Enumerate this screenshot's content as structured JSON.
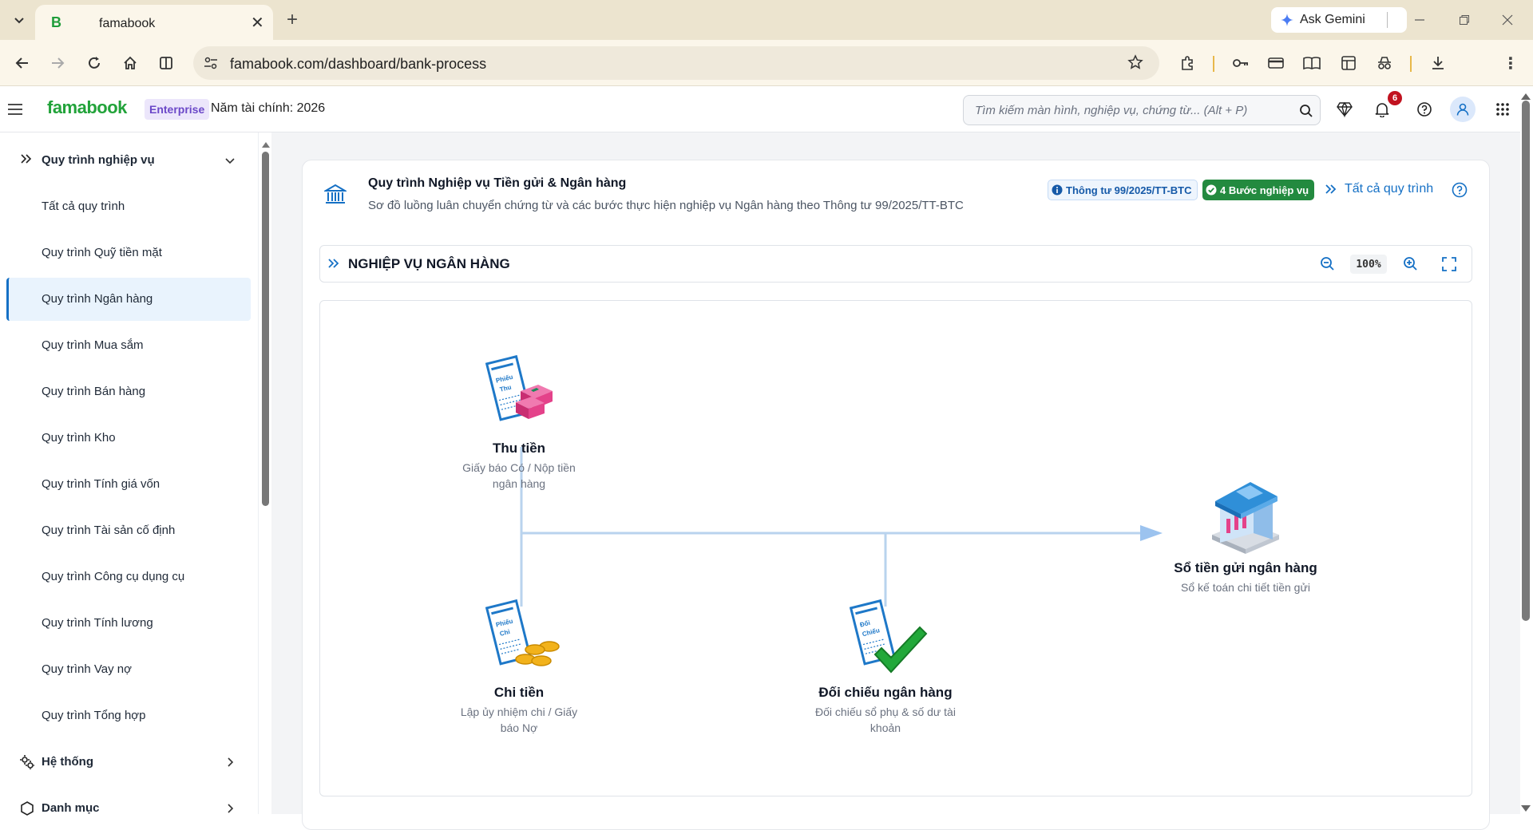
{
  "browser": {
    "tab_title": "famabook",
    "favicon_letter": "B",
    "url": "famabook.com/dashboard/bank-process",
    "gemini_label": "Ask Gemini"
  },
  "app": {
    "brand": "famabook",
    "plan_badge": "Enterprise",
    "fiscal_year": "Năm tài chính: 2026",
    "search_placeholder": "Tìm kiếm màn hình, nghiệp vụ, chứng từ... (Alt + P)",
    "notification_count": "6"
  },
  "sidebar": {
    "group_title": "Quy trình nghiệp vụ",
    "items": [
      {
        "label": "Tất cả quy trình"
      },
      {
        "label": "Quy trình Quỹ tiền mặt"
      },
      {
        "label": "Quy trình Ngân hàng",
        "active": true
      },
      {
        "label": "Quy trình Mua sắm"
      },
      {
        "label": "Quy trình Bán hàng"
      },
      {
        "label": "Quy trình Kho"
      },
      {
        "label": "Quy trình Tính giá vốn"
      },
      {
        "label": "Quy trình Tài sản cố định"
      },
      {
        "label": "Quy trình Công cụ dụng cụ"
      },
      {
        "label": "Quy trình Tính lương"
      },
      {
        "label": "Quy trình Vay nợ"
      },
      {
        "label": "Quy trình Tổng hợp"
      }
    ],
    "system_title": "Hệ thống",
    "catalog_title": "Danh mục"
  },
  "page": {
    "title": "Quy trình Nghiệp vụ Tiền gửi & Ngân hàng",
    "subtitle": "Sơ đồ luồng luân chuyển chứng từ và các bước thực hiện nghiệp vụ Ngân hàng theo Thông tư 99/2025/TT-BTC",
    "circular_badge": "Thông tư 99/2025/TT-BTC",
    "steps_badge": "4 Bước nghiệp vụ",
    "all_processes_link": "Tất cả quy trình",
    "section_title": "NGHIỆP VỤ NGÂN HÀNG",
    "zoom": "100%"
  },
  "diagram": {
    "nodes": {
      "receipt": {
        "title": "Thu tiền",
        "desc": "Giấy báo Có / Nộp tiền ngân hàng",
        "doc_text1": "Phiếu",
        "doc_text2": "Thu"
      },
      "payment": {
        "title": "Chi tiền",
        "desc": "Lập ủy nhiệm chi / Giấy báo Nợ",
        "doc_text1": "Phiếu",
        "doc_text2": "Chi"
      },
      "reconcile": {
        "title": "Đối chiếu ngân hàng",
        "desc": "Đối chiếu sổ phụ & số dư tài khoản",
        "doc_text1": "Đối",
        "doc_text2": "Chiếu"
      },
      "ledger": {
        "title": "Sổ tiền gửi ngân hàng",
        "desc": "Sổ kế toán chi tiết tiền gửi"
      }
    },
    "colors": {
      "connector": "#b9d3ee",
      "arrow": "#9cc3ef",
      "doc_border": "#1e78c8",
      "cash_box": "#e4428a",
      "coins": "#f2b21b",
      "check": "#22a83a",
      "bank": "#2f8fd8"
    }
  }
}
